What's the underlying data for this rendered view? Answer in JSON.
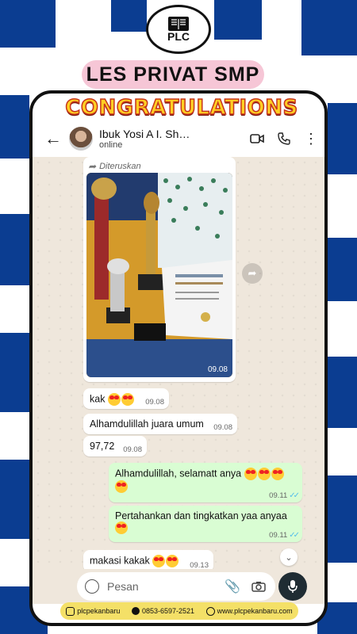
{
  "brand": {
    "logo_text": "PLC",
    "banner": "LES PRIVAT SMP",
    "congrats": "CONGRATULATIONS"
  },
  "chat_header": {
    "contact_name": "Ibuk Yosi A I. Sh…",
    "status": "online"
  },
  "messages": {
    "image": {
      "forwarded_label": "Diteruskan",
      "time": "09.08"
    },
    "m1": {
      "text": "kak ",
      "time": "09.08"
    },
    "m2": {
      "text": "Alhamdulillah juara umum",
      "time": "09.08"
    },
    "m3": {
      "text": "97,72",
      "time": "09.08"
    },
    "m4": {
      "text": "Alhamdulillah, selamatt anya ",
      "time": "09.11"
    },
    "m5": {
      "text": "Pertahankan dan tingkatkan yaa anyaa",
      "time": "09.11"
    },
    "m6": {
      "text": "makasi kakak ",
      "time": "09.13"
    }
  },
  "composer": {
    "placeholder": "Pesan"
  },
  "footer": {
    "instagram": "plcpekanbaru",
    "phone": "0853-6597-2521",
    "website": "www.plcpekanbaru.com"
  },
  "colors": {
    "checker": "#0b3d91",
    "banner": "#f6c6d6",
    "outgoing_bubble": "#d9fdd3",
    "chat_bg": "#efe7dc",
    "footer_bg": "#f4e067"
  }
}
